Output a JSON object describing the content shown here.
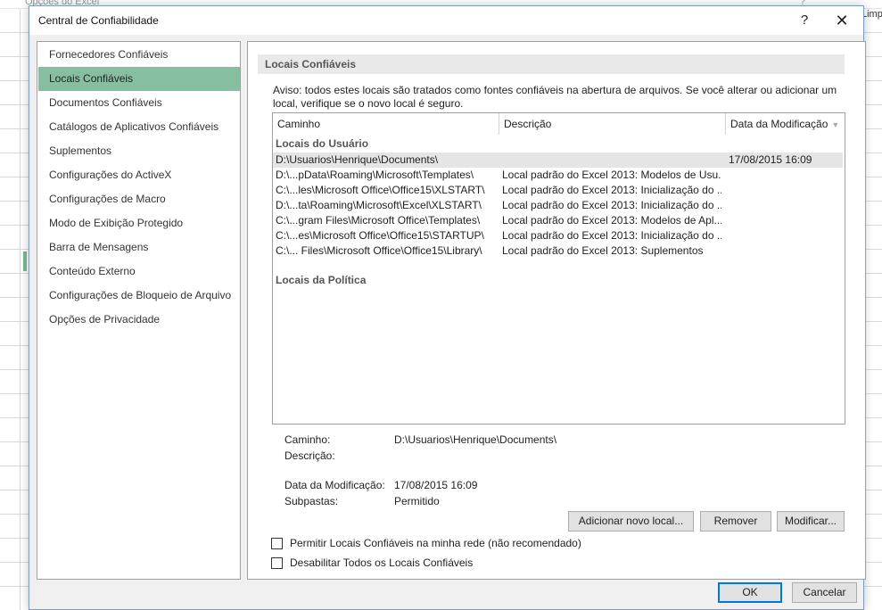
{
  "background": {
    "title": "Opções do Excel",
    "help": "?",
    "side_text": "Limp"
  },
  "dialog": {
    "title": "Central de Confiabilidade",
    "help_icon": "?",
    "close_icon": "✕"
  },
  "nav": {
    "items": [
      {
        "label": "Fornecedores Confiáveis"
      },
      {
        "label": "Locais Confiáveis",
        "selected": true
      },
      {
        "label": "Documentos Confiáveis"
      },
      {
        "label": "Catálogos de Aplicativos Confiáveis"
      },
      {
        "label": "Suplementos"
      },
      {
        "label": "Configurações do ActiveX"
      },
      {
        "label": "Configurações de Macro"
      },
      {
        "label": "Modo de Exibição Protegido"
      },
      {
        "label": "Barra de Mensagens"
      },
      {
        "label": "Conteúdo Externo"
      },
      {
        "label": "Configurações de Bloqueio de Arquivo"
      },
      {
        "label": "Opções de Privacidade"
      }
    ]
  },
  "main": {
    "section_title": "Locais Confiáveis",
    "warning": "Aviso: todos estes locais são tratados como fontes confiáveis na abertura de arquivos. Se você alterar ou adicionar um local, verifique se o novo local é seguro.",
    "columns": [
      "Caminho",
      "Descrição",
      "Data da Modificação"
    ],
    "sort_icon": "▼",
    "user_group_label": "Locais do Usuário",
    "policy_group_label": "Locais da Política",
    "user_rows": [
      {
        "path": "D:\\Usuarios\\Henrique\\Documents\\",
        "description": "",
        "date": "17/08/2015 16:09",
        "selected": true
      },
      {
        "path": "D:\\...pData\\Roaming\\Microsoft\\Templates\\",
        "description": "Local padrão do Excel 2013: Modelos de Usu...",
        "date": ""
      },
      {
        "path": "C:\\...les\\Microsoft Office\\Office15\\XLSTART\\",
        "description": "Local padrão do Excel 2013: Inicialização do ...",
        "date": ""
      },
      {
        "path": "D:\\...ta\\Roaming\\Microsoft\\Excel\\XLSTART\\",
        "description": "Local padrão do Excel 2013: Inicialização do ...",
        "date": ""
      },
      {
        "path": "C:\\...gram Files\\Microsoft Office\\Templates\\",
        "description": "Local padrão do Excel 2013: Modelos de Apl...",
        "date": ""
      },
      {
        "path": "C:\\...es\\Microsoft Office\\Office15\\STARTUP\\",
        "description": "Local padrão do Excel 2013: Inicialização do ...",
        "date": ""
      },
      {
        "path": "C:\\... Files\\Microsoft Office\\Office15\\Library\\",
        "description": "Local padrão do Excel 2013: Suplementos",
        "date": ""
      }
    ],
    "details": {
      "path_label": "Caminho:",
      "path_value": "D:\\Usuarios\\Henrique\\Documents\\",
      "description_label": "Descrição:",
      "description_value": "",
      "modified_label": "Data da Modificação:",
      "modified_value": "17/08/2015 16:09",
      "subfolders_label": "Subpastas:",
      "subfolders_value": "Permitido"
    },
    "buttons": {
      "add": "Adicionar novo local...",
      "remove": "Remover",
      "modify": "Modificar..."
    },
    "checkboxes": {
      "network": {
        "label": "Permitir Locais Confiáveis na minha rede (não recomendado)",
        "checked": false
      },
      "disable_all": {
        "label": "Desabilitar Todos os Locais Confiáveis",
        "checked": false
      }
    }
  },
  "footer": {
    "ok": "OK",
    "cancel": "Cancelar"
  }
}
